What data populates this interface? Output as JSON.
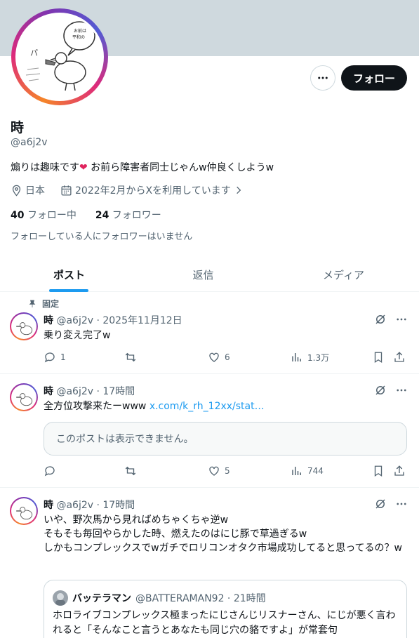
{
  "profile": {
    "name": "時",
    "handle": "@a6j2v",
    "bio_part1": "煽りは趣味です",
    "bio_heart": "❤",
    "bio_part2": " お前ら障害者同士じゃんw仲良くしようw",
    "location": "日本",
    "joined": "2022年2月からXを利用しています",
    "following_count": "40",
    "following_label": "フォロー中",
    "followers_count": "24",
    "followers_label": "フォロワー",
    "followers_note": "フォローしている人にフォロワーはいません",
    "follow_button": "フォロー"
  },
  "tabs": [
    {
      "label": "ポスト",
      "active": true
    },
    {
      "label": "返信",
      "active": false
    },
    {
      "label": "メディア",
      "active": false
    }
  ],
  "posts": [
    {
      "pinned_label": "固定",
      "name": "時",
      "meta": "@a6j2v · 2025年11月12日",
      "text": "乗り変え完了w",
      "replies": "1",
      "reposts": "",
      "likes": "6",
      "views": "1.3万"
    },
    {
      "name": "時",
      "meta": "@a6j2v · 17時間",
      "text": "全方位攻撃来たーwww ",
      "link": "x.com/k_rh_12xx/stat…",
      "unavailable": "このポストは表示できません。",
      "replies": "",
      "reposts": "",
      "likes": "5",
      "views": "744"
    },
    {
      "name": "時",
      "meta": "@a6j2v · 17時間",
      "lines": [
        "いや、野次馬から見ればめちゃくちゃ逆w",
        "そもそも毎回やらかした時、燃えたのはにじ豚で草過ぎるw",
        "しかもコンプレックスでwガチでロリコンオタク市場成功してると思ってるの？w"
      ],
      "quote": {
        "name": "バッテラマン",
        "meta": "@BATTERAMAN92 · 21時間",
        "text": "ホロライブコンプレックス極まったにじさんじリスナーさん、にじが悪く言われると「そんなこと言うとあなたも同じ穴の貉ですよ」が常套句"
      }
    }
  ],
  "colors": {
    "accent": "#1d9bf0",
    "text": "#0f1419",
    "muted": "#536471",
    "banner": "#cfd9de"
  }
}
